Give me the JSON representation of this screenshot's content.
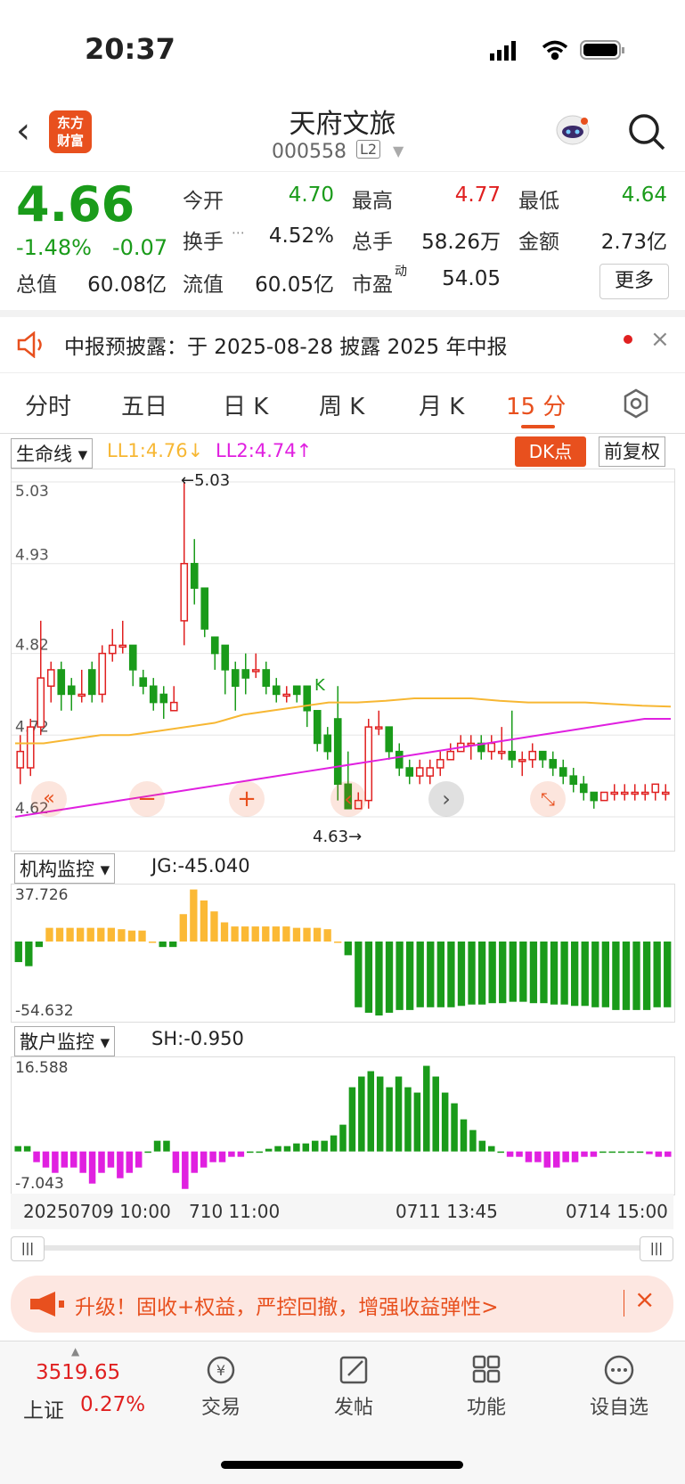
{
  "status": {
    "time": "20:37"
  },
  "header": {
    "name": "天府文旅",
    "code": "000558",
    "badge": "L2",
    "logo_line1": "东方",
    "logo_line2": "财富"
  },
  "quote": {
    "price": "4.66",
    "pct": "-1.48%",
    "change": "-0.07",
    "open_label": "今开",
    "open": "4.70",
    "high_label": "最高",
    "high": "4.77",
    "low_label": "最低",
    "low": "4.64",
    "turnover_label": "换手",
    "turnover": "4.52%",
    "volume_label": "总手",
    "volume": "58.26万",
    "amount_label": "金额",
    "amount": "2.73亿",
    "mktcap_label": "总值",
    "mktcap": "60.08亿",
    "float_label": "流值",
    "float": "60.05亿",
    "pe_label": "市盈",
    "pe_sup": "动",
    "pe": "54.05",
    "more": "更多"
  },
  "notice": {
    "text": "中报预披露：于 2025-08-28 披露 2025 年中报"
  },
  "tabs": [
    "分时",
    "五日",
    "日 K",
    "周 K",
    "月 K",
    "15 分"
  ],
  "main_panel": {
    "indicator": "生命线",
    "ll1": "LL1:4.76↓",
    "ll2": "LL2:4.74↑",
    "dk": "DK点",
    "adjust": "前复权",
    "max_label": "←5.03",
    "min_label": "4.63→",
    "k_mark": "K"
  },
  "chart_data": [
    {
      "type": "candlestick",
      "y_ticks": [
        "5.03",
        "4.93",
        "4.82",
        "4.72",
        "4.62"
      ],
      "ylim": [
        4.62,
        5.03
      ],
      "candles": [
        [
          4.68,
          4.7,
          4.72,
          4.66
        ],
        [
          4.68,
          4.73,
          4.74,
          4.67
        ],
        [
          4.73,
          4.79,
          4.86,
          4.72
        ],
        [
          4.78,
          4.8,
          4.81,
          4.76
        ],
        [
          4.8,
          4.77,
          4.81,
          4.75
        ],
        [
          4.78,
          4.77,
          4.79,
          4.75
        ],
        [
          4.77,
          4.77,
          4.8,
          4.76
        ],
        [
          4.8,
          4.77,
          4.81,
          4.76
        ],
        [
          4.77,
          4.82,
          4.83,
          4.76
        ],
        [
          4.82,
          4.83,
          4.85,
          4.81
        ],
        [
          4.83,
          4.83,
          4.86,
          4.82
        ],
        [
          4.83,
          4.8,
          4.83,
          4.78
        ],
        [
          4.79,
          4.78,
          4.8,
          4.77
        ],
        [
          4.78,
          4.76,
          4.79,
          4.75
        ],
        [
          4.77,
          4.76,
          4.78,
          4.74
        ],
        [
          4.75,
          4.76,
          4.78,
          4.75
        ],
        [
          4.86,
          4.93,
          5.03,
          4.83
        ],
        [
          4.93,
          4.9,
          4.96,
          4.88
        ],
        [
          4.9,
          4.85,
          4.9,
          4.84
        ],
        [
          4.84,
          4.82,
          4.84,
          4.8
        ],
        [
          4.83,
          4.8,
          4.83,
          4.77
        ],
        [
          4.8,
          4.78,
          4.81,
          4.75
        ],
        [
          4.8,
          4.79,
          4.82,
          4.77
        ],
        [
          4.8,
          4.8,
          4.82,
          4.79
        ],
        [
          4.8,
          4.78,
          4.81,
          4.77
        ],
        [
          4.78,
          4.77,
          4.79,
          4.76
        ],
        [
          4.77,
          4.77,
          4.78,
          4.76
        ],
        [
          4.78,
          4.77,
          4.78,
          4.76
        ],
        [
          4.78,
          4.75,
          4.78,
          4.73
        ],
        [
          4.75,
          4.71,
          4.75,
          4.7
        ],
        [
          4.72,
          4.7,
          4.73,
          4.69
        ],
        [
          4.74,
          4.66,
          4.78,
          4.64
        ],
        [
          4.66,
          4.63,
          4.7,
          4.63
        ],
        [
          4.63,
          4.64,
          4.65,
          4.63
        ],
        [
          4.64,
          4.73,
          4.74,
          4.63
        ],
        [
          4.73,
          4.73,
          4.75,
          4.72
        ],
        [
          4.73,
          4.7,
          4.72,
          4.69
        ],
        [
          4.7,
          4.68,
          4.71,
          4.67
        ],
        [
          4.68,
          4.67,
          4.69,
          4.66
        ],
        [
          4.67,
          4.68,
          4.69,
          4.66
        ],
        [
          4.67,
          4.68,
          4.69,
          4.66
        ],
        [
          4.68,
          4.69,
          4.7,
          4.67
        ],
        [
          4.69,
          4.7,
          4.71,
          4.69
        ],
        [
          4.7,
          4.71,
          4.72,
          4.7
        ],
        [
          4.71,
          4.71,
          4.72,
          4.69
        ],
        [
          4.71,
          4.7,
          4.72,
          4.69
        ],
        [
          4.7,
          4.71,
          4.72,
          4.69
        ],
        [
          4.7,
          4.7,
          4.73,
          4.69
        ],
        [
          4.7,
          4.69,
          4.75,
          4.68
        ],
        [
          4.69,
          4.69,
          4.7,
          4.67
        ],
        [
          4.69,
          4.7,
          4.71,
          4.68
        ],
        [
          4.7,
          4.69,
          4.7,
          4.68
        ],
        [
          4.69,
          4.68,
          4.7,
          4.67
        ],
        [
          4.68,
          4.67,
          4.69,
          4.66
        ],
        [
          4.67,
          4.66,
          4.68,
          4.65
        ],
        [
          4.66,
          4.65,
          4.67,
          4.64
        ],
        [
          4.65,
          4.64,
          4.65,
          4.63
        ],
        [
          4.64,
          4.65,
          4.65,
          4.64
        ],
        [
          4.65,
          4.65,
          4.66,
          4.64
        ],
        [
          4.65,
          4.65,
          4.66,
          4.64
        ],
        [
          4.65,
          4.65,
          4.66,
          4.64
        ],
        [
          4.65,
          4.65,
          4.66,
          4.64
        ],
        [
          4.65,
          4.66,
          4.66,
          4.64
        ],
        [
          4.65,
          4.65,
          4.66,
          4.64
        ]
      ],
      "series": [
        {
          "name": "LL1",
          "color": "#f7b733",
          "values": [
            4.71,
            4.71,
            4.715,
            4.72,
            4.72,
            4.725,
            4.73,
            4.735,
            4.745,
            4.75,
            4.755,
            4.76,
            4.76,
            4.762,
            4.765,
            4.765,
            4.765,
            4.762,
            4.76,
            4.76,
            4.76,
            4.758,
            4.756,
            4.755
          ]
        },
        {
          "name": "LL2",
          "color": "#e020e0",
          "values": [
            4.62,
            4.625,
            4.63,
            4.635,
            4.64,
            4.645,
            4.65,
            4.655,
            4.66,
            4.665,
            4.67,
            4.675,
            4.68,
            4.685,
            4.69,
            4.695,
            4.7,
            4.705,
            4.71,
            4.715,
            4.72,
            4.725,
            4.73,
            4.735,
            4.74,
            4.74
          ]
        }
      ]
    },
    {
      "type": "bar",
      "name": "JG",
      "value_label": "JG:-45.040",
      "indicator": "机构监控",
      "ymax_label": "37.726",
      "ymin_label": "-54.632",
      "ylim": [
        -54.632,
        37.726
      ],
      "values": [
        -15,
        -18,
        -4,
        10,
        10,
        10,
        10,
        10,
        10,
        10,
        9,
        8,
        8,
        0,
        -4,
        -4,
        20,
        38,
        30,
        22,
        14,
        11,
        11,
        11,
        11,
        11,
        11,
        10,
        10,
        10,
        9,
        0,
        -10,
        -48,
        -52,
        -54,
        -52,
        -50,
        -50,
        -48,
        -48,
        -48,
        -48,
        -47,
        -46,
        -46,
        -45,
        -45,
        -44,
        -44,
        -45,
        -45,
        -46,
        -46,
        -47,
        -47,
        -48,
        -48,
        -50,
        -50,
        -50,
        -50,
        -48,
        -48
      ]
    },
    {
      "type": "bar",
      "name": "SH",
      "value_label": "SH:-0.950",
      "indicator": "散户监控",
      "ymax_label": "16.588",
      "ymin_label": "-7.043",
      "ylim": [
        -7.043,
        16.588
      ],
      "values": [
        1,
        1,
        -2,
        -3,
        -4,
        -3,
        -3,
        -4,
        -6,
        -4,
        -3,
        -5,
        -4,
        -3,
        0,
        2,
        2,
        -4,
        -7,
        -4,
        -3,
        -2,
        -2,
        -1,
        -1,
        0,
        0,
        0.5,
        1,
        1,
        1.5,
        1.5,
        2,
        2,
        3,
        5,
        12,
        14,
        15,
        14,
        12,
        14,
        12,
        11,
        16,
        14,
        11,
        9,
        6,
        4,
        2,
        1,
        0,
        -1,
        -1,
        -2,
        -2,
        -3,
        -3,
        -2,
        -2,
        -1,
        -1,
        0,
        0,
        0,
        0,
        0,
        -0.5,
        -1,
        -1
      ]
    }
  ],
  "time_axis": [
    "20250709 10:00",
    "710 11:00",
    "0711 13:45",
    "0714 15:00"
  ],
  "banner": {
    "text": "升级！固收+权益，严控回撤，增强收益弹性>"
  },
  "bottom_nav": {
    "index_value": "3519.65",
    "index_name": "上证",
    "index_pct": "0.27%",
    "trade": "交易",
    "post": "发帖",
    "func": "功能",
    "watch": "设自选"
  }
}
